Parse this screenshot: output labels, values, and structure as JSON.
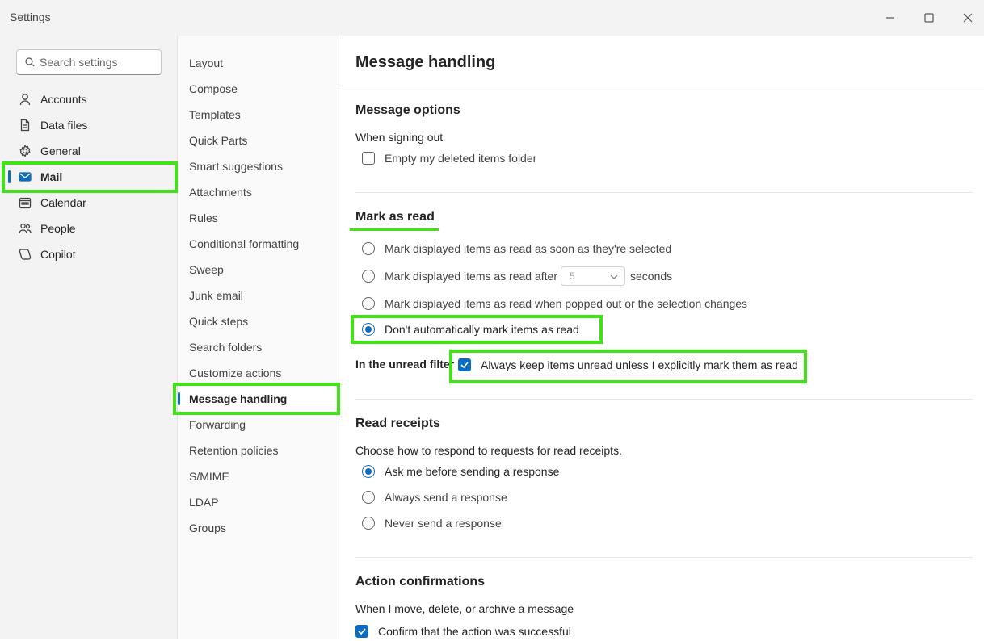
{
  "window": {
    "title": "Settings",
    "controls": [
      "minimize-icon",
      "maximize-icon",
      "close-icon"
    ]
  },
  "search": {
    "placeholder": "Search settings",
    "icon": "search-icon"
  },
  "sidebar": {
    "items": [
      {
        "label": "Accounts",
        "icon": "person-icon"
      },
      {
        "label": "Data files",
        "icon": "document-icon"
      },
      {
        "label": "General",
        "icon": "gear-icon"
      },
      {
        "label": "Mail",
        "icon": "mail-icon",
        "selected": true
      },
      {
        "label": "Calendar",
        "icon": "calendar-icon"
      },
      {
        "label": "People",
        "icon": "people-icon"
      },
      {
        "label": "Copilot",
        "icon": "copilot-icon"
      }
    ]
  },
  "subnav": {
    "items": [
      "Layout",
      "Compose",
      "Templates",
      "Quick Parts",
      "Smart suggestions",
      "Attachments",
      "Rules",
      "Conditional formatting",
      "Sweep",
      "Junk email",
      "Quick steps",
      "Search folders",
      "Customize actions",
      "Message handling",
      "Forwarding",
      "Retention policies",
      "S/MIME",
      "LDAP",
      "Groups"
    ],
    "selected": "Message handling"
  },
  "main": {
    "title": "Message handling",
    "message_options": {
      "title": "Message options",
      "signout_label": "When signing out",
      "empty_deleted": {
        "label": "Empty my deleted items folder",
        "checked": false
      }
    },
    "mark_as_read": {
      "title": "Mark as read",
      "options": [
        {
          "label": "Mark displayed items as read as soon as they're selected",
          "selected": false
        },
        {
          "label": "Mark displayed items as read after",
          "selected": false
        },
        {
          "label": "Mark displayed items as read when popped out or the selection changes",
          "selected": false
        },
        {
          "label": "Don't automatically mark items as read",
          "selected": true
        }
      ],
      "delay_value": "5",
      "delay_unit": "seconds",
      "unread_filter_label": "In the unread filter",
      "keep_unread": {
        "label": "Always keep items unread unless I explicitly mark them as read",
        "checked": true
      }
    },
    "read_receipts": {
      "title": "Read receipts",
      "description": "Choose how to respond to requests for read receipts.",
      "options": [
        {
          "label": "Ask me before sending a response",
          "selected": true
        },
        {
          "label": "Always send a response",
          "selected": false
        },
        {
          "label": "Never send a response",
          "selected": false
        }
      ]
    },
    "action_confirmations": {
      "title": "Action confirmations",
      "description": "When I move, delete, or archive a message",
      "confirm": {
        "label": "Confirm that the action was successful",
        "checked": true
      }
    }
  },
  "colors": {
    "accent": "#0f6cbd",
    "highlight": "#44e01c"
  }
}
